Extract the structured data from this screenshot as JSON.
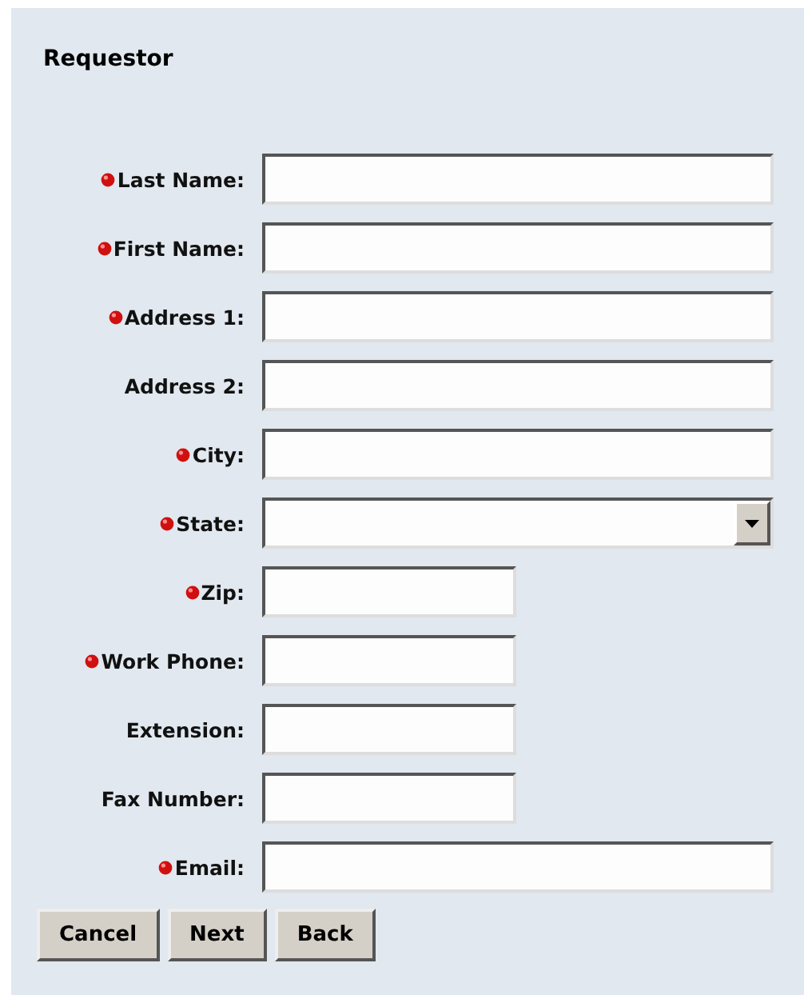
{
  "section": {
    "title": "Requestor"
  },
  "fields": [
    {
      "label": "Last Name:",
      "required": true,
      "kind": "text"
    },
    {
      "label": "First Name:",
      "required": true,
      "kind": "text"
    },
    {
      "label": "Address 1:",
      "required": true,
      "kind": "text"
    },
    {
      "label": "Address 2:",
      "required": false,
      "kind": "text"
    },
    {
      "label": "City:",
      "required": true,
      "kind": "text"
    },
    {
      "label": "State:",
      "required": true,
      "kind": "select"
    },
    {
      "label": "Zip:",
      "required": true,
      "kind": "shorttext"
    },
    {
      "label": "Work Phone:",
      "required": true,
      "kind": "shorttext"
    },
    {
      "label": "Extension:",
      "required": false,
      "kind": "shorttext"
    },
    {
      "label": "Fax Number:",
      "required": false,
      "kind": "shorttext"
    },
    {
      "label": "Email:",
      "required": true,
      "kind": "text"
    }
  ],
  "buttons": [
    "Cancel",
    "Next",
    "Back"
  ]
}
